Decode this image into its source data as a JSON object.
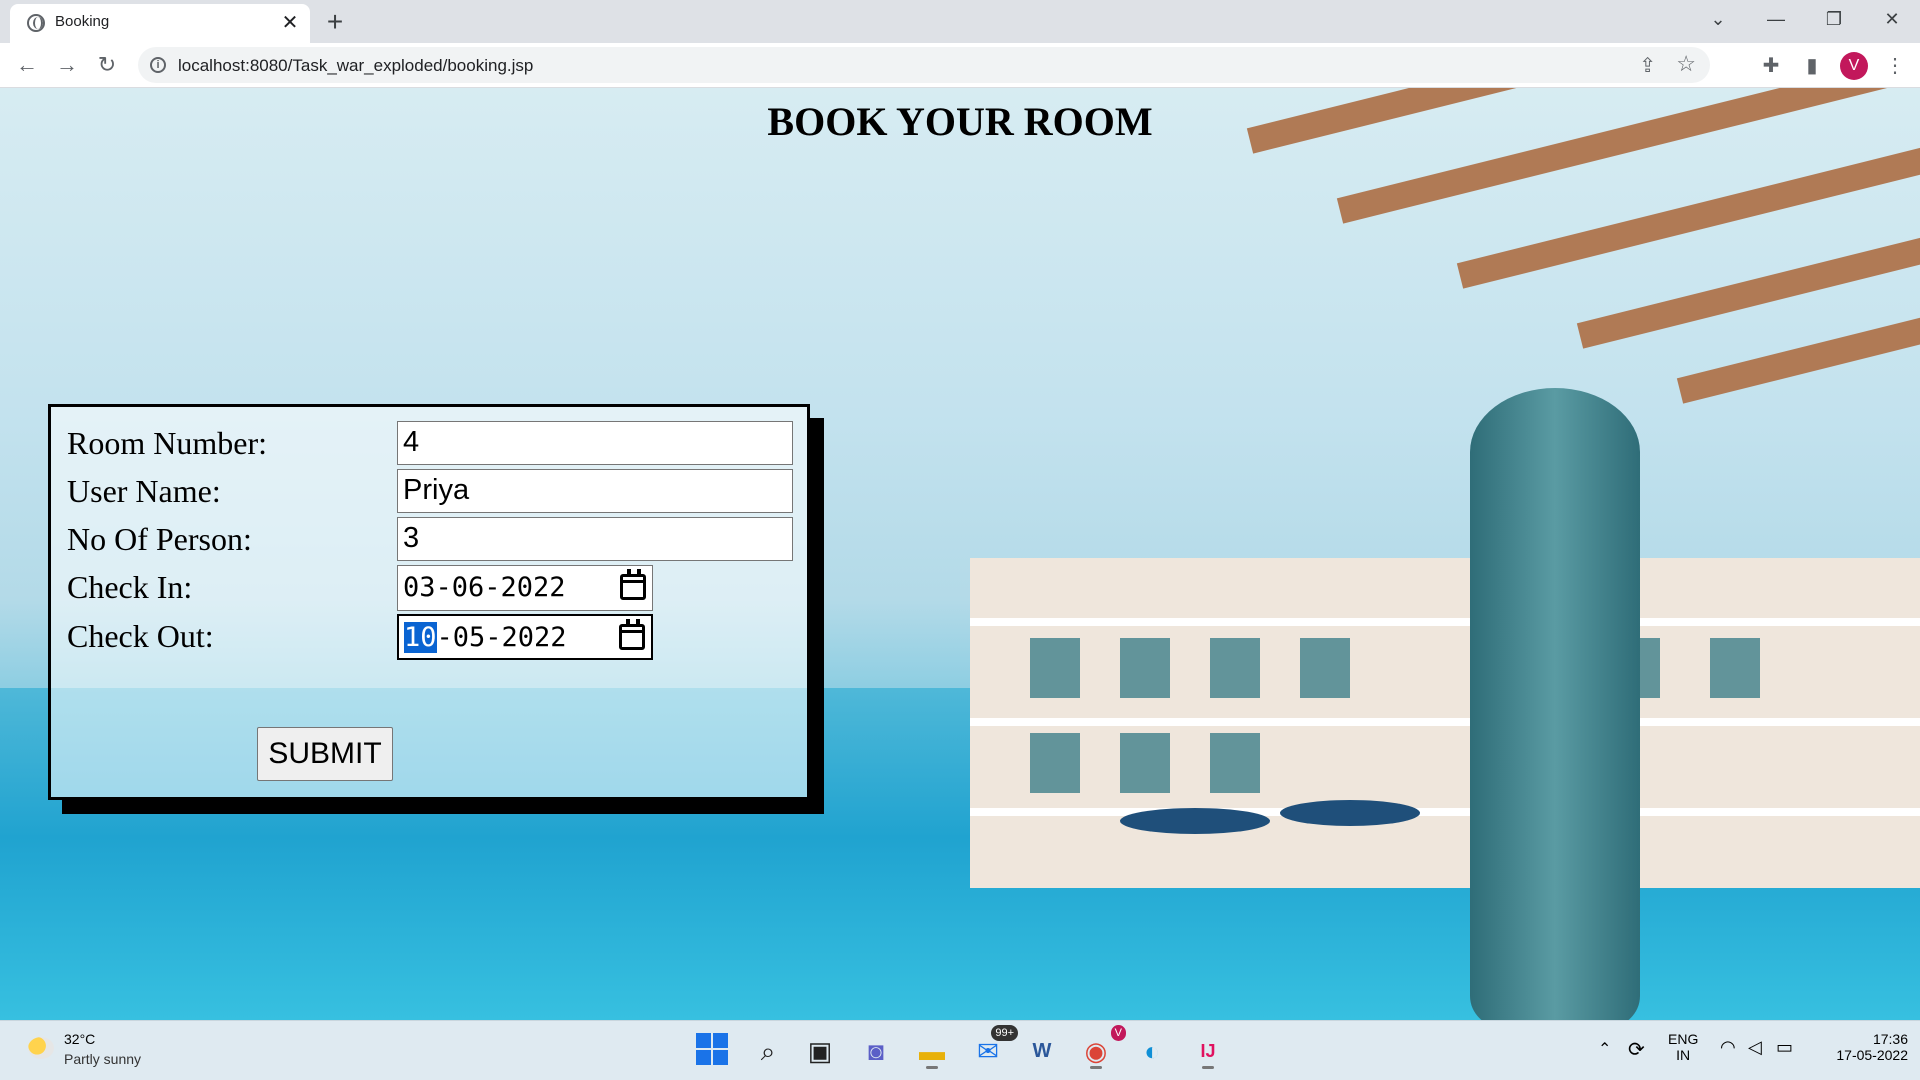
{
  "browser": {
    "tab_title": "Booking",
    "tab_close": "✕",
    "new_tab": "+",
    "url": "localhost:8080/Task_war_exploded/booking.jsp",
    "profile_initial": "V",
    "window_controls": {
      "minimize": "—",
      "maximize": "❐",
      "close": "✕",
      "tab_search": "⌄"
    },
    "nav": {
      "back": "←",
      "forward": "→",
      "reload": "↻"
    }
  },
  "page": {
    "title": "BOOK YOUR ROOM",
    "form": {
      "room_number_label": "Room Number:",
      "room_number_value": "4",
      "user_name_label": "User Name:",
      "user_name_value": "Priya",
      "persons_label": "No Of Person:",
      "persons_value": "3",
      "check_in_label": "Check In:",
      "check_in_value": "03-06-2022",
      "check_out_label": "Check Out:",
      "check_out_day": "10",
      "check_out_rest": "-05-2022",
      "submit_label": "SUBMIT"
    }
  },
  "taskbar": {
    "weather_temp": "32°C",
    "weather_condition": "Partly sunny",
    "mail_badge": "99+",
    "chrome_badge": "V",
    "language_top": "ENG",
    "language_bottom": "IN",
    "time": "17:36",
    "date": "17-05-2022",
    "icons": [
      "start-icon",
      "search-icon",
      "task-view-icon",
      "chat-icon",
      "file-explorer-icon",
      "mail-icon",
      "word-icon",
      "chrome-icon",
      "edge-icon",
      "intellij-icon"
    ]
  }
}
